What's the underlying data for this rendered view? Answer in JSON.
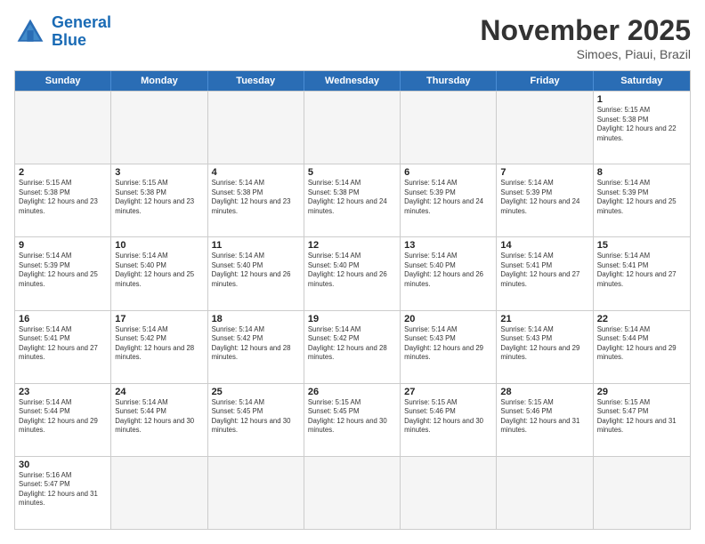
{
  "logo": {
    "line1": "General",
    "line2": "Blue"
  },
  "calendar": {
    "title": "November 2025",
    "subtitle": "Simoes, Piaui, Brazil",
    "days_of_week": [
      "Sunday",
      "Monday",
      "Tuesday",
      "Wednesday",
      "Thursday",
      "Friday",
      "Saturday"
    ],
    "weeks": [
      [
        {
          "day": "",
          "info": "",
          "empty": true
        },
        {
          "day": "",
          "info": "",
          "empty": true
        },
        {
          "day": "",
          "info": "",
          "empty": true
        },
        {
          "day": "",
          "info": "",
          "empty": true
        },
        {
          "day": "",
          "info": "",
          "empty": true
        },
        {
          "day": "",
          "info": "",
          "empty": true
        },
        {
          "day": "1",
          "info": "Sunrise: 5:15 AM\nSunset: 5:38 PM\nDaylight: 12 hours and 22 minutes."
        }
      ],
      [
        {
          "day": "2",
          "info": "Sunrise: 5:15 AM\nSunset: 5:38 PM\nDaylight: 12 hours and 23 minutes."
        },
        {
          "day": "3",
          "info": "Sunrise: 5:15 AM\nSunset: 5:38 PM\nDaylight: 12 hours and 23 minutes."
        },
        {
          "day": "4",
          "info": "Sunrise: 5:14 AM\nSunset: 5:38 PM\nDaylight: 12 hours and 23 minutes."
        },
        {
          "day": "5",
          "info": "Sunrise: 5:14 AM\nSunset: 5:38 PM\nDaylight: 12 hours and 24 minutes."
        },
        {
          "day": "6",
          "info": "Sunrise: 5:14 AM\nSunset: 5:39 PM\nDaylight: 12 hours and 24 minutes."
        },
        {
          "day": "7",
          "info": "Sunrise: 5:14 AM\nSunset: 5:39 PM\nDaylight: 12 hours and 24 minutes."
        },
        {
          "day": "8",
          "info": "Sunrise: 5:14 AM\nSunset: 5:39 PM\nDaylight: 12 hours and 25 minutes."
        }
      ],
      [
        {
          "day": "9",
          "info": "Sunrise: 5:14 AM\nSunset: 5:39 PM\nDaylight: 12 hours and 25 minutes."
        },
        {
          "day": "10",
          "info": "Sunrise: 5:14 AM\nSunset: 5:40 PM\nDaylight: 12 hours and 25 minutes."
        },
        {
          "day": "11",
          "info": "Sunrise: 5:14 AM\nSunset: 5:40 PM\nDaylight: 12 hours and 26 minutes."
        },
        {
          "day": "12",
          "info": "Sunrise: 5:14 AM\nSunset: 5:40 PM\nDaylight: 12 hours and 26 minutes."
        },
        {
          "day": "13",
          "info": "Sunrise: 5:14 AM\nSunset: 5:40 PM\nDaylight: 12 hours and 26 minutes."
        },
        {
          "day": "14",
          "info": "Sunrise: 5:14 AM\nSunset: 5:41 PM\nDaylight: 12 hours and 27 minutes."
        },
        {
          "day": "15",
          "info": "Sunrise: 5:14 AM\nSunset: 5:41 PM\nDaylight: 12 hours and 27 minutes."
        }
      ],
      [
        {
          "day": "16",
          "info": "Sunrise: 5:14 AM\nSunset: 5:41 PM\nDaylight: 12 hours and 27 minutes."
        },
        {
          "day": "17",
          "info": "Sunrise: 5:14 AM\nSunset: 5:42 PM\nDaylight: 12 hours and 28 minutes."
        },
        {
          "day": "18",
          "info": "Sunrise: 5:14 AM\nSunset: 5:42 PM\nDaylight: 12 hours and 28 minutes."
        },
        {
          "day": "19",
          "info": "Sunrise: 5:14 AM\nSunset: 5:42 PM\nDaylight: 12 hours and 28 minutes."
        },
        {
          "day": "20",
          "info": "Sunrise: 5:14 AM\nSunset: 5:43 PM\nDaylight: 12 hours and 29 minutes."
        },
        {
          "day": "21",
          "info": "Sunrise: 5:14 AM\nSunset: 5:43 PM\nDaylight: 12 hours and 29 minutes."
        },
        {
          "day": "22",
          "info": "Sunrise: 5:14 AM\nSunset: 5:44 PM\nDaylight: 12 hours and 29 minutes."
        }
      ],
      [
        {
          "day": "23",
          "info": "Sunrise: 5:14 AM\nSunset: 5:44 PM\nDaylight: 12 hours and 29 minutes."
        },
        {
          "day": "24",
          "info": "Sunrise: 5:14 AM\nSunset: 5:44 PM\nDaylight: 12 hours and 30 minutes."
        },
        {
          "day": "25",
          "info": "Sunrise: 5:14 AM\nSunset: 5:45 PM\nDaylight: 12 hours and 30 minutes."
        },
        {
          "day": "26",
          "info": "Sunrise: 5:15 AM\nSunset: 5:45 PM\nDaylight: 12 hours and 30 minutes."
        },
        {
          "day": "27",
          "info": "Sunrise: 5:15 AM\nSunset: 5:46 PM\nDaylight: 12 hours and 30 minutes."
        },
        {
          "day": "28",
          "info": "Sunrise: 5:15 AM\nSunset: 5:46 PM\nDaylight: 12 hours and 31 minutes."
        },
        {
          "day": "29",
          "info": "Sunrise: 5:15 AM\nSunset: 5:47 PM\nDaylight: 12 hours and 31 minutes."
        }
      ],
      [
        {
          "day": "30",
          "info": "Sunrise: 5:16 AM\nSunset: 5:47 PM\nDaylight: 12 hours and 31 minutes."
        },
        {
          "day": "",
          "info": "",
          "empty": true
        },
        {
          "day": "",
          "info": "",
          "empty": true
        },
        {
          "day": "",
          "info": "",
          "empty": true
        },
        {
          "day": "",
          "info": "",
          "empty": true
        },
        {
          "day": "",
          "info": "",
          "empty": true
        },
        {
          "day": "",
          "info": "",
          "empty": true
        }
      ]
    ]
  }
}
